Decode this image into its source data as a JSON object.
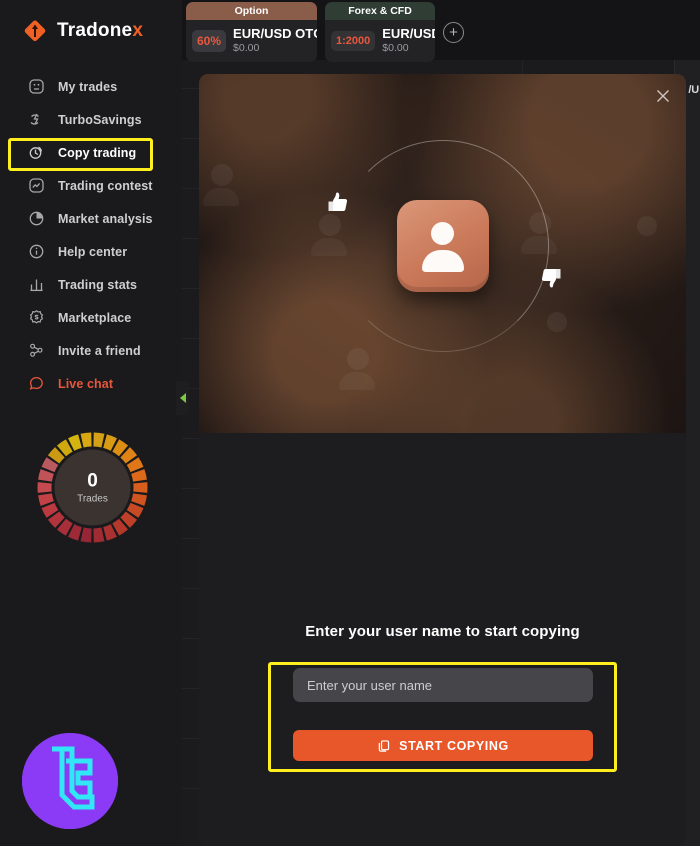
{
  "brand": {
    "name": "Tradone",
    "accent_letter": "x",
    "logo_icon": "diamond-arrow-logo",
    "accent_color": "#ef6024"
  },
  "sidebar": {
    "items": [
      {
        "label": "My trades",
        "icon": "trades-icon",
        "active": false
      },
      {
        "label": "TurboSavings",
        "icon": "turbo-savings-icon",
        "active": false
      },
      {
        "label": "Copy trading",
        "icon": "copy-trading-icon",
        "active": true
      },
      {
        "label": "Trading contest",
        "icon": "trading-contest-icon",
        "active": false
      },
      {
        "label": "Market analysis",
        "icon": "pie-chart-icon",
        "active": false
      },
      {
        "label": "Help center",
        "icon": "info-circle-icon",
        "active": false
      },
      {
        "label": "Trading stats",
        "icon": "bar-chart-icon",
        "active": false
      },
      {
        "label": "Marketplace",
        "icon": "marketplace-icon",
        "active": false
      },
      {
        "label": "Invite a friend",
        "icon": "invite-friend-icon",
        "active": false
      },
      {
        "label": "Live chat",
        "icon": "chat-bubble-icon",
        "active": false
      }
    ],
    "trades_widget": {
      "count": "0",
      "caption": "Trades"
    },
    "collapse_icon": "chevron-left-icon",
    "watermark_icon": "lc-monogram-logo"
  },
  "topbar": {
    "tabs": [
      {
        "kind": "Option",
        "badge": "60%",
        "symbol": "EUR/USD OTC",
        "amount": "$0.00"
      },
      {
        "kind": "Forex & CFD",
        "badge": "1:2000",
        "symbol": "EUR/USD",
        "amount": "$0.00"
      }
    ],
    "add_tab_icon": "plus-circle-icon"
  },
  "modal": {
    "close_icon": "close-icon",
    "hero_icon": "copy-trading-illustration",
    "form": {
      "title": "Enter your user name to start copying",
      "input_value": "",
      "input_placeholder": "Enter your user name",
      "submit_label": "START COPYING",
      "submit_icon": "copy-icon",
      "submit_color": "#e8572a"
    }
  },
  "background_chart": {
    "price_axis_label": "/U",
    "candles": [
      {
        "color": "#5fc04a",
        "direction": "up"
      },
      {
        "color": "#e8563c",
        "direction": "down"
      }
    ]
  }
}
